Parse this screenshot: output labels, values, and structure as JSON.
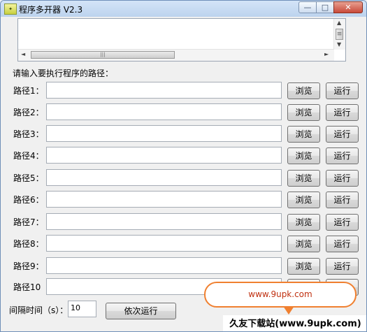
{
  "window": {
    "title": "程序多开器 V2.3",
    "icon": "app-icon",
    "controls": {
      "minimize_icon": "minimize-icon",
      "maximize_icon": "maximize-icon",
      "close_icon": "close-icon",
      "minimize": "—",
      "maximize": "□",
      "close": "✕"
    }
  },
  "log": {
    "scroll_arrows": {
      "up": "▲",
      "down": "▼",
      "left": "◄",
      "right": "►"
    },
    "h_grip": "|||",
    "v_grip": "≡"
  },
  "instruction": "请输入要执行程序的路径：",
  "rows": [
    {
      "label": "路径1：",
      "value": "",
      "browse": "浏览",
      "run": "运行"
    },
    {
      "label": "路径2：",
      "value": "",
      "browse": "浏览",
      "run": "运行"
    },
    {
      "label": "路径3：",
      "value": "",
      "browse": "浏览",
      "run": "运行"
    },
    {
      "label": "路径4：",
      "value": "",
      "browse": "浏览",
      "run": "运行"
    },
    {
      "label": "路径5：",
      "value": "",
      "browse": "浏览",
      "run": "运行"
    },
    {
      "label": "路径6：",
      "value": "",
      "browse": "浏览",
      "run": "运行"
    },
    {
      "label": "路径7：",
      "value": "",
      "browse": "浏览",
      "run": "运行"
    },
    {
      "label": "路径8：",
      "value": "",
      "browse": "浏览",
      "run": "运行"
    },
    {
      "label": "路径9：",
      "value": "",
      "browse": "浏览",
      "run": "运行"
    },
    {
      "label": "路径10",
      "value": "",
      "browse": "浏览",
      "run": "运行"
    }
  ],
  "interval": {
    "label": "间隔时间（s）：",
    "value": "10"
  },
  "sequential_run": "依次运行",
  "watermark": {
    "bubble": "www.9upk.com",
    "bar": "久友下载站(www.9upk.com)"
  }
}
